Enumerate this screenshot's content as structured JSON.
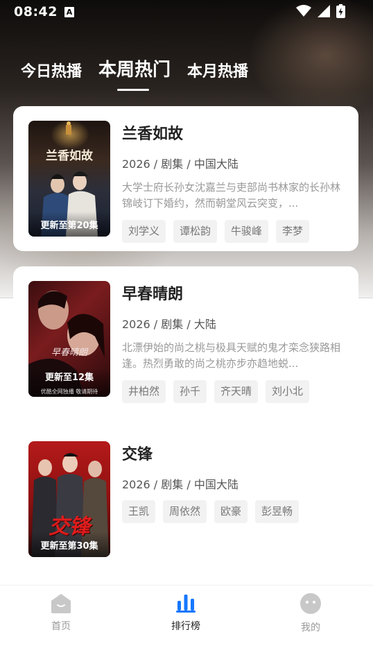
{
  "status_bar": {
    "time": "08:42",
    "notif_letter": "A"
  },
  "tabs": [
    {
      "label": "今日热播",
      "active": false
    },
    {
      "label": "本周热门",
      "active": true
    },
    {
      "label": "本月热播",
      "active": false
    }
  ],
  "dramas": [
    {
      "title": "兰香如故",
      "meta": "2026 / 剧集 / 中国大陆",
      "description": "大学士府长孙女沈嘉兰与吏部尚书林家的长孙林锦岐订下婚约，然而朝堂风云突变，...",
      "actors": [
        "刘学义",
        "谭松韵",
        "牛骏峰",
        "李梦"
      ],
      "update": "更新至第20集",
      "poster_title": "兰香如故"
    },
    {
      "title": "早春晴朗",
      "meta": "2026 / 剧集 / 大陆",
      "description": "北漂伊始的尚之桃与极具天赋的鬼才栾念狭路相逢。热烈勇敢的尚之桃亦步亦趋地蜕...",
      "actors": [
        "井柏然",
        "孙千",
        "齐天晴",
        "刘小北"
      ],
      "update": "更新至12集",
      "poster_title": "早春晴朗",
      "poster_sub": "优酷全网独播 敬请期待"
    },
    {
      "title": "交锋",
      "meta": "2026 / 剧集 / 中国大陆",
      "description": "",
      "actors": [
        "王凯",
        "周依然",
        "欧豪",
        "彭昱畅"
      ],
      "update": "更新至第30集",
      "poster_title": "交锋"
    }
  ],
  "bottom_nav": [
    {
      "label": "首页",
      "icon": "home-icon",
      "active": false
    },
    {
      "label": "排行榜",
      "icon": "ranking-icon",
      "active": true
    },
    {
      "label": "我的",
      "icon": "profile-icon",
      "active": false
    }
  ],
  "colors": {
    "accent": "#1677ff",
    "inactive": "#c8c8c8"
  }
}
